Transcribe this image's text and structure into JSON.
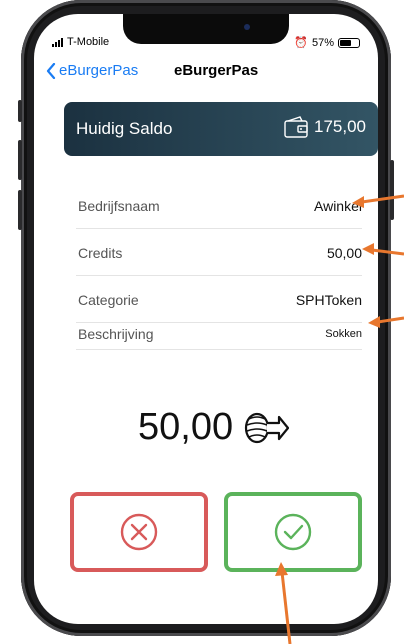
{
  "status_bar": {
    "carrier": "T-Mobile",
    "battery": "57%"
  },
  "nav": {
    "back_label": "eBurgerPas",
    "title": "eBurgerPas"
  },
  "balance": {
    "label": "Huidig Saldo",
    "amount": "175,00"
  },
  "details": [
    {
      "key": "Bedrijfsnaam",
      "value": "Awinkel"
    },
    {
      "key": "Credits",
      "value": "50,00"
    },
    {
      "key": "Categorie",
      "value": "SPHToken"
    },
    {
      "key": "Beschrijving",
      "value": "Sokken"
    }
  ],
  "transfer": {
    "amount": "50,00"
  },
  "colors": {
    "accent_blue": "#1a7cf3",
    "balance_bg_start": "#1b3140",
    "balance_bg_end": "#335565",
    "cancel_red": "#d85a5a",
    "confirm_green": "#5bb35b",
    "annotation_orange": "#e8772e"
  },
  "icons": {
    "back": "chevron-left-icon",
    "wallet": "wallet-icon",
    "coin_transfer": "coin-hand-transfer-icon",
    "cancel": "x-circle-icon",
    "confirm": "check-circle-icon"
  }
}
